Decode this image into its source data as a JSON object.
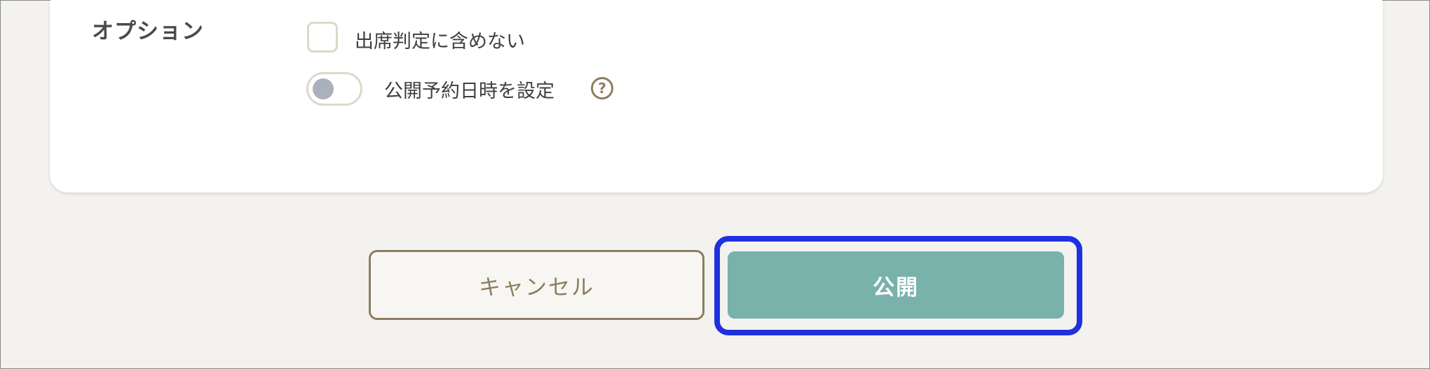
{
  "options": {
    "section_label": "オプション",
    "exclude_attendance": {
      "label": "出席判定に含めない",
      "checked": false
    },
    "schedule_publish": {
      "label": "公開予約日時を設定",
      "enabled": false,
      "help_icon": "question-circle-icon"
    }
  },
  "actions": {
    "cancel_label": "キャンセル",
    "publish_label": "公開"
  },
  "colors": {
    "accent_border": "#8c7d5f",
    "publish_bg": "#79b1ab",
    "focus_ring": "#1f30e0"
  }
}
